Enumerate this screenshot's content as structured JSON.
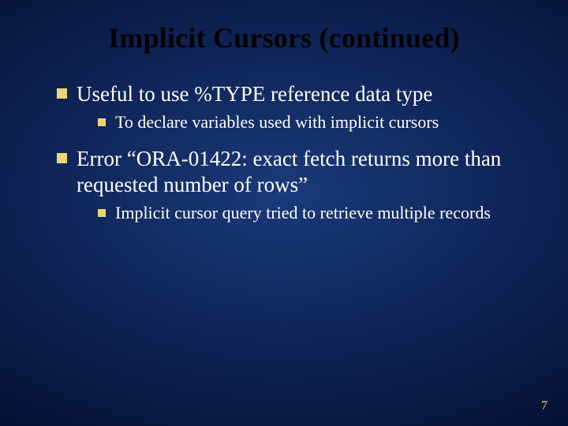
{
  "title": "Implicit Cursors (continued)",
  "items": [
    {
      "text": "Useful to use %TYPE reference data type",
      "sub": [
        {
          "text": "To declare variables used with implicit cursors"
        }
      ]
    },
    {
      "text": "Error “ORA-01422: exact fetch returns more than requested number of rows”",
      "sub": [
        {
          "text": "Implicit cursor query tried to retrieve multiple records"
        }
      ]
    }
  ],
  "page_number": "7"
}
